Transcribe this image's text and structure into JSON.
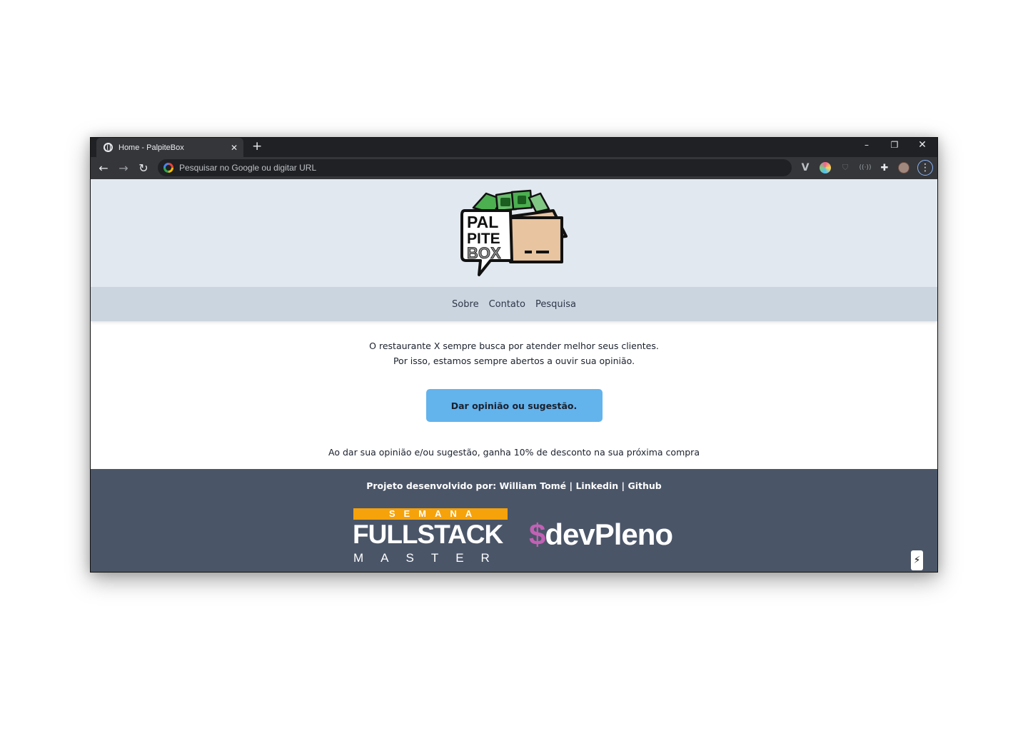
{
  "browser": {
    "tab_title": "Home - PalpiteBox",
    "tab_close": "✕",
    "new_tab": "+",
    "win_min": "–",
    "win_max": "❐",
    "win_close": "✕",
    "omnibox_placeholder": "Pesquisar no Google ou digitar URL",
    "back": "←",
    "forward": "→",
    "reload": "↻",
    "extensions": {
      "v": "V",
      "shield": "⛉",
      "radio": "((·))",
      "puzzle": "✚",
      "menu": "⋮"
    }
  },
  "site": {
    "logo_text": [
      "PAL",
      "PITE",
      "BOX"
    ],
    "nav": [
      "Sobre",
      "Contato",
      "Pesquisa"
    ],
    "intro_line1": "O restaurante X sempre busca por atender melhor seus clientes.",
    "intro_line2": "Por isso, estamos sempre abertos a ouvir sua opinião.",
    "cta_label": "Dar opinião ou sugestão.",
    "promo": "Ao dar sua opinião e/ou sugestão, ganha 10% de desconto na sua próxima compra",
    "footer": {
      "credit_prefix": "Projeto desenvolvido por: ",
      "author": "William Tomé",
      "sep1": " | ",
      "linkedin": "Linkedin",
      "sep2": " | ",
      "github": "Github",
      "fs_band": "SEMANA",
      "fs_main": "FULLSTACK",
      "fs_sub": "MASTER",
      "dev_dollar": "$",
      "dev_name": "devPleno",
      "flash_icon": "⚡"
    }
  },
  "colors": {
    "header_bg": "#e2e8f0",
    "nav_bg": "#cbd5e0",
    "cta_bg": "#63b3ed",
    "footer_bg": "#4a5568",
    "fs_orange": "#f6a20a",
    "dev_pink": "#c261b5"
  }
}
